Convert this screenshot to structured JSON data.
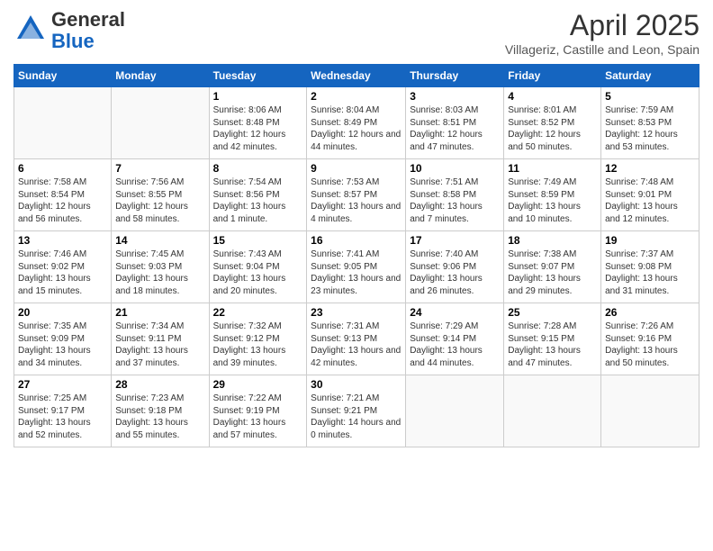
{
  "logo": {
    "general": "General",
    "blue": "Blue"
  },
  "header": {
    "month": "April 2025",
    "location": "Villageriz, Castille and Leon, Spain"
  },
  "days_of_week": [
    "Sunday",
    "Monday",
    "Tuesday",
    "Wednesday",
    "Thursday",
    "Friday",
    "Saturday"
  ],
  "weeks": [
    [
      {
        "day": "",
        "info": ""
      },
      {
        "day": "",
        "info": ""
      },
      {
        "day": "1",
        "info": "Sunrise: 8:06 AM\nSunset: 8:48 PM\nDaylight: 12 hours and 42 minutes."
      },
      {
        "day": "2",
        "info": "Sunrise: 8:04 AM\nSunset: 8:49 PM\nDaylight: 12 hours and 44 minutes."
      },
      {
        "day": "3",
        "info": "Sunrise: 8:03 AM\nSunset: 8:51 PM\nDaylight: 12 hours and 47 minutes."
      },
      {
        "day": "4",
        "info": "Sunrise: 8:01 AM\nSunset: 8:52 PM\nDaylight: 12 hours and 50 minutes."
      },
      {
        "day": "5",
        "info": "Sunrise: 7:59 AM\nSunset: 8:53 PM\nDaylight: 12 hours and 53 minutes."
      }
    ],
    [
      {
        "day": "6",
        "info": "Sunrise: 7:58 AM\nSunset: 8:54 PM\nDaylight: 12 hours and 56 minutes."
      },
      {
        "day": "7",
        "info": "Sunrise: 7:56 AM\nSunset: 8:55 PM\nDaylight: 12 hours and 58 minutes."
      },
      {
        "day": "8",
        "info": "Sunrise: 7:54 AM\nSunset: 8:56 PM\nDaylight: 13 hours and 1 minute."
      },
      {
        "day": "9",
        "info": "Sunrise: 7:53 AM\nSunset: 8:57 PM\nDaylight: 13 hours and 4 minutes."
      },
      {
        "day": "10",
        "info": "Sunrise: 7:51 AM\nSunset: 8:58 PM\nDaylight: 13 hours and 7 minutes."
      },
      {
        "day": "11",
        "info": "Sunrise: 7:49 AM\nSunset: 8:59 PM\nDaylight: 13 hours and 10 minutes."
      },
      {
        "day": "12",
        "info": "Sunrise: 7:48 AM\nSunset: 9:01 PM\nDaylight: 13 hours and 12 minutes."
      }
    ],
    [
      {
        "day": "13",
        "info": "Sunrise: 7:46 AM\nSunset: 9:02 PM\nDaylight: 13 hours and 15 minutes."
      },
      {
        "day": "14",
        "info": "Sunrise: 7:45 AM\nSunset: 9:03 PM\nDaylight: 13 hours and 18 minutes."
      },
      {
        "day": "15",
        "info": "Sunrise: 7:43 AM\nSunset: 9:04 PM\nDaylight: 13 hours and 20 minutes."
      },
      {
        "day": "16",
        "info": "Sunrise: 7:41 AM\nSunset: 9:05 PM\nDaylight: 13 hours and 23 minutes."
      },
      {
        "day": "17",
        "info": "Sunrise: 7:40 AM\nSunset: 9:06 PM\nDaylight: 13 hours and 26 minutes."
      },
      {
        "day": "18",
        "info": "Sunrise: 7:38 AM\nSunset: 9:07 PM\nDaylight: 13 hours and 29 minutes."
      },
      {
        "day": "19",
        "info": "Sunrise: 7:37 AM\nSunset: 9:08 PM\nDaylight: 13 hours and 31 minutes."
      }
    ],
    [
      {
        "day": "20",
        "info": "Sunrise: 7:35 AM\nSunset: 9:09 PM\nDaylight: 13 hours and 34 minutes."
      },
      {
        "day": "21",
        "info": "Sunrise: 7:34 AM\nSunset: 9:11 PM\nDaylight: 13 hours and 37 minutes."
      },
      {
        "day": "22",
        "info": "Sunrise: 7:32 AM\nSunset: 9:12 PM\nDaylight: 13 hours and 39 minutes."
      },
      {
        "day": "23",
        "info": "Sunrise: 7:31 AM\nSunset: 9:13 PM\nDaylight: 13 hours and 42 minutes."
      },
      {
        "day": "24",
        "info": "Sunrise: 7:29 AM\nSunset: 9:14 PM\nDaylight: 13 hours and 44 minutes."
      },
      {
        "day": "25",
        "info": "Sunrise: 7:28 AM\nSunset: 9:15 PM\nDaylight: 13 hours and 47 minutes."
      },
      {
        "day": "26",
        "info": "Sunrise: 7:26 AM\nSunset: 9:16 PM\nDaylight: 13 hours and 50 minutes."
      }
    ],
    [
      {
        "day": "27",
        "info": "Sunrise: 7:25 AM\nSunset: 9:17 PM\nDaylight: 13 hours and 52 minutes."
      },
      {
        "day": "28",
        "info": "Sunrise: 7:23 AM\nSunset: 9:18 PM\nDaylight: 13 hours and 55 minutes."
      },
      {
        "day": "29",
        "info": "Sunrise: 7:22 AM\nSunset: 9:19 PM\nDaylight: 13 hours and 57 minutes."
      },
      {
        "day": "30",
        "info": "Sunrise: 7:21 AM\nSunset: 9:21 PM\nDaylight: 14 hours and 0 minutes."
      },
      {
        "day": "",
        "info": ""
      },
      {
        "day": "",
        "info": ""
      },
      {
        "day": "",
        "info": ""
      }
    ]
  ]
}
